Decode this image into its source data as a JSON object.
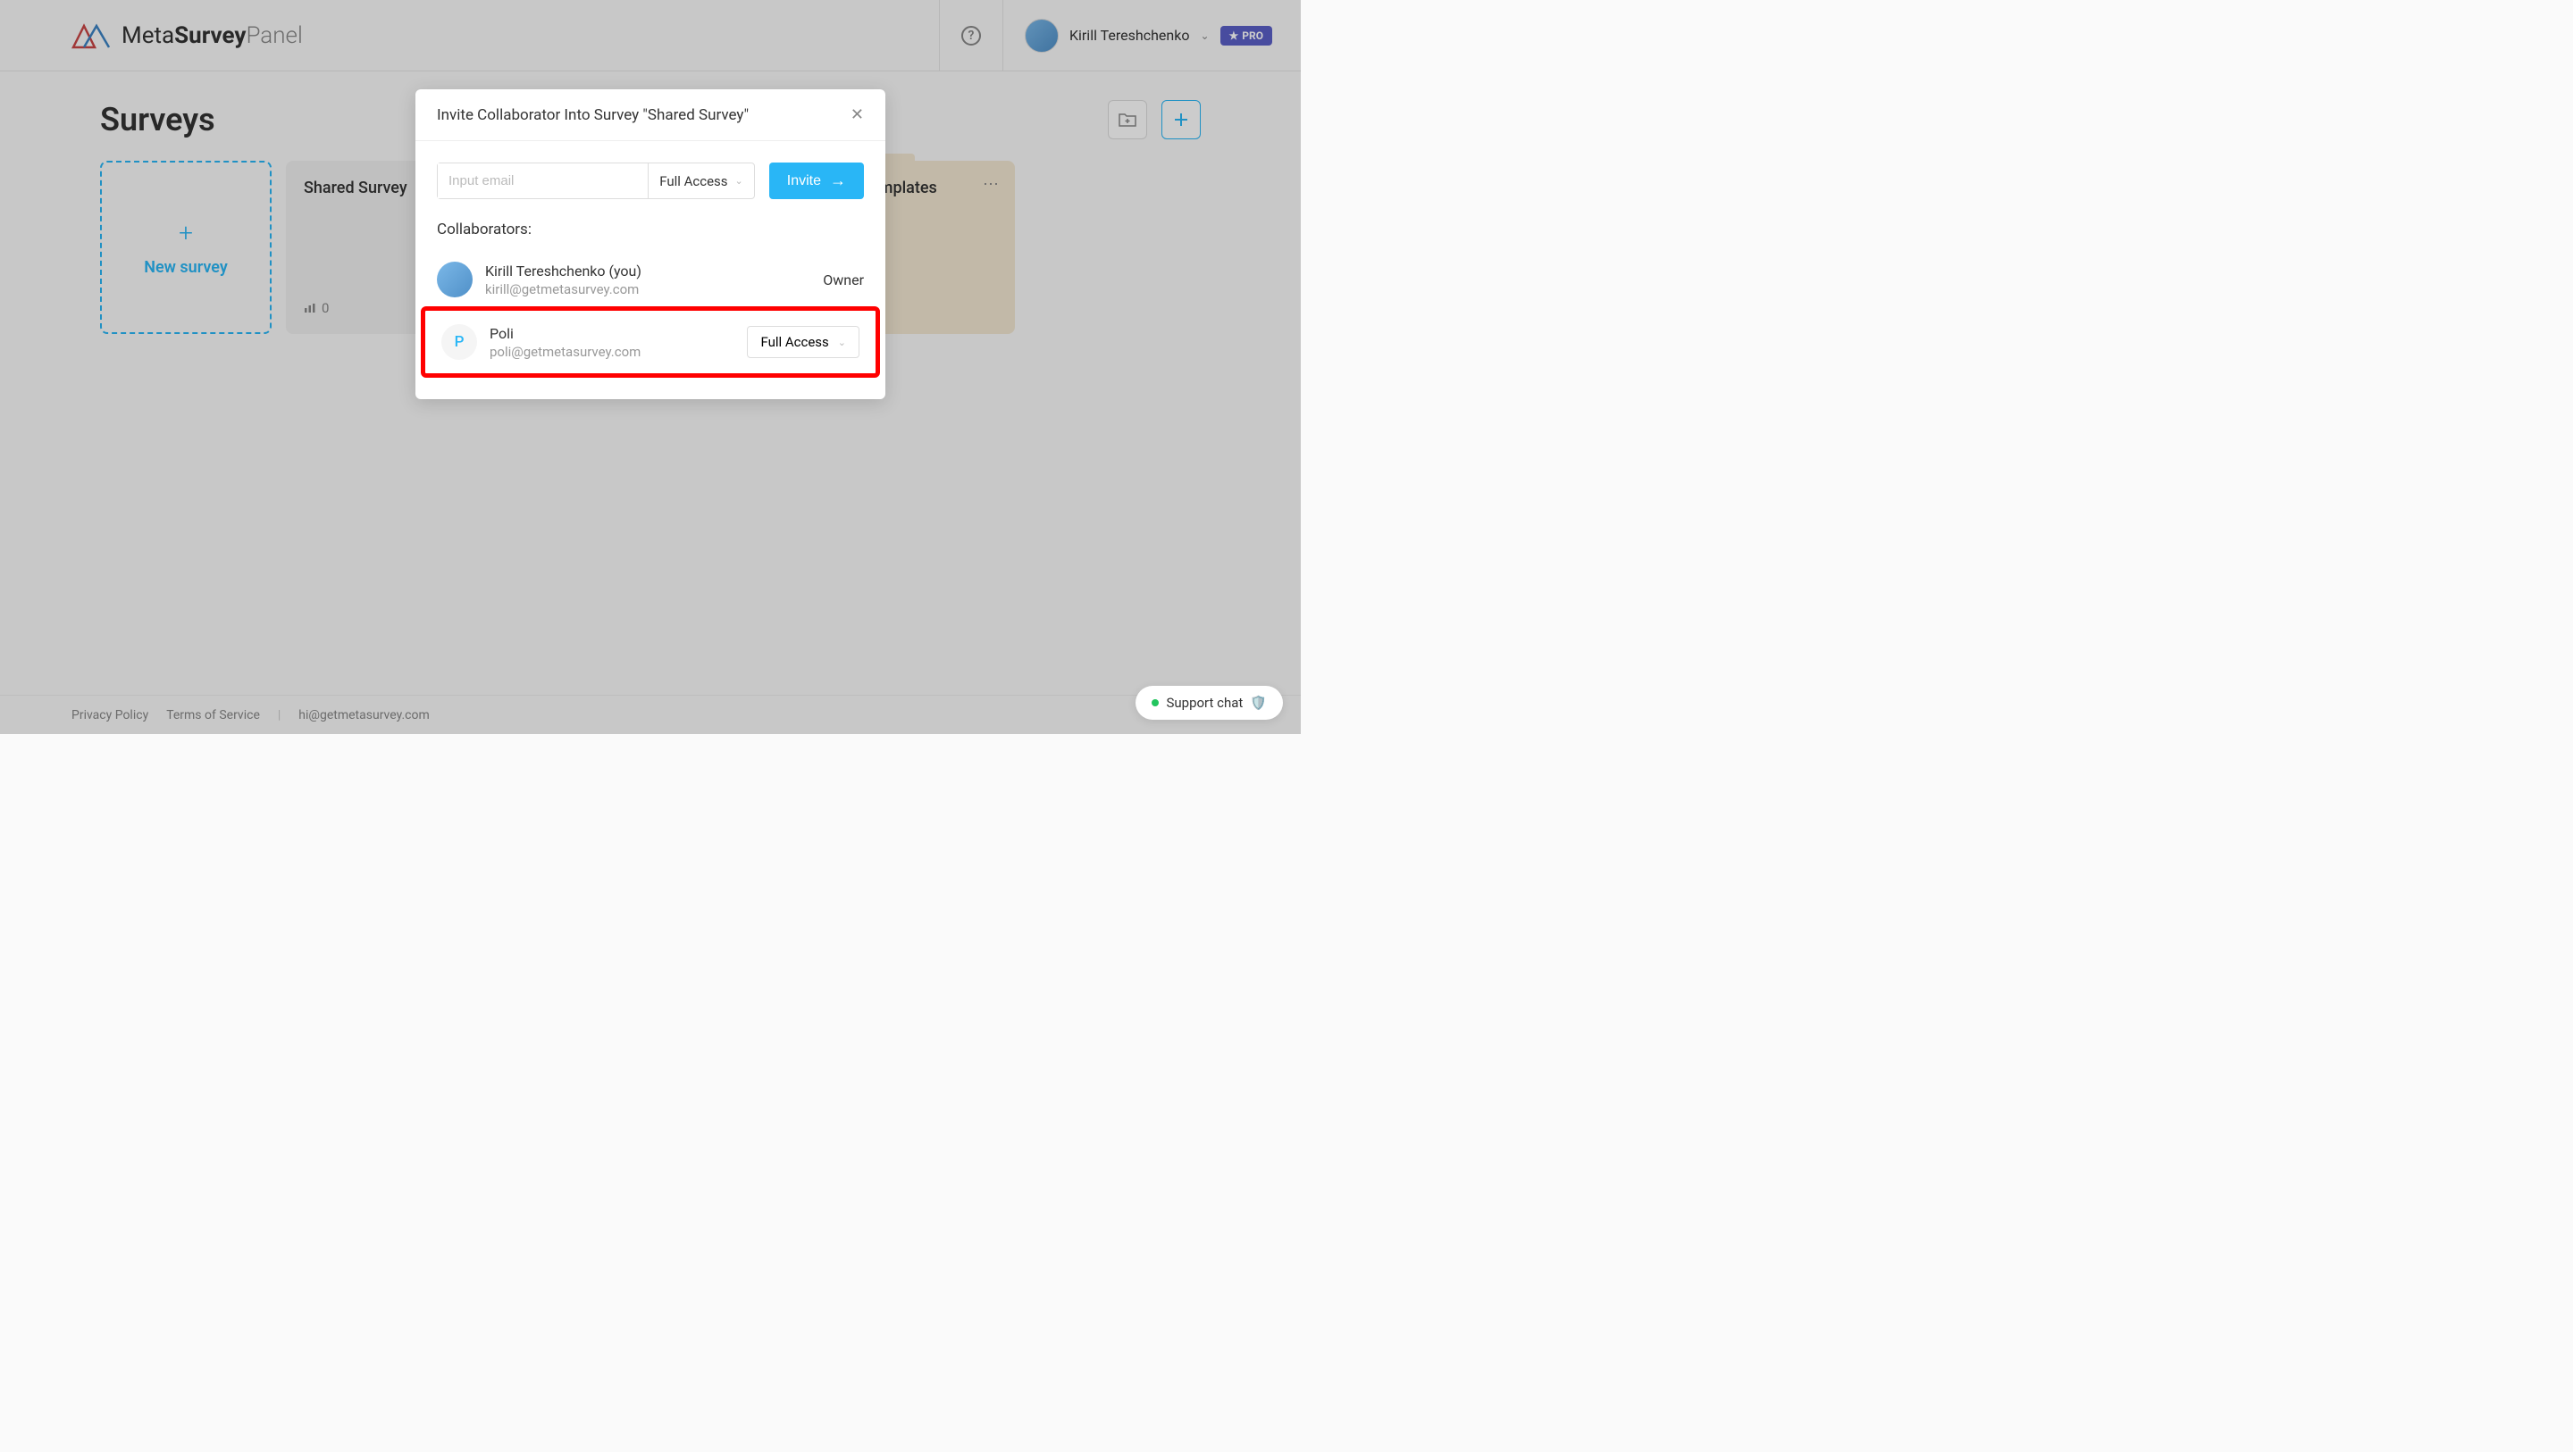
{
  "header": {
    "logo_meta": "Meta",
    "logo_survey": "Survey",
    "logo_panel": "Panel",
    "user_name": "Kirill Tereshchenko",
    "pro_label": "PRO"
  },
  "main": {
    "title": "Surveys",
    "new_survey_label": "New survey"
  },
  "surveys": [
    {
      "title": "Shared Survey",
      "count": "0"
    }
  ],
  "templates_card": {
    "title": "Templates"
  },
  "modal": {
    "title": "Invite Collaborator Into Survey \"Shared Survey\"",
    "email_placeholder": "Input email",
    "access_label": "Full Access",
    "invite_label": "Invite",
    "collaborators_label": "Collaborators:",
    "collaborators": [
      {
        "name": "Kirill Tereshchenko (you)",
        "email": "kirill@getmetasurvey.com",
        "role": "Owner",
        "avatar_type": "image"
      },
      {
        "name": "Poli",
        "email": "poli@getmetasurvey.com",
        "role": "Full Access",
        "avatar_letter": "P",
        "avatar_type": "letter"
      }
    ]
  },
  "footer": {
    "privacy": "Privacy Policy",
    "terms": "Terms of Service",
    "email": "hi@getmetasurvey.com"
  },
  "support": {
    "label": "Support chat"
  }
}
